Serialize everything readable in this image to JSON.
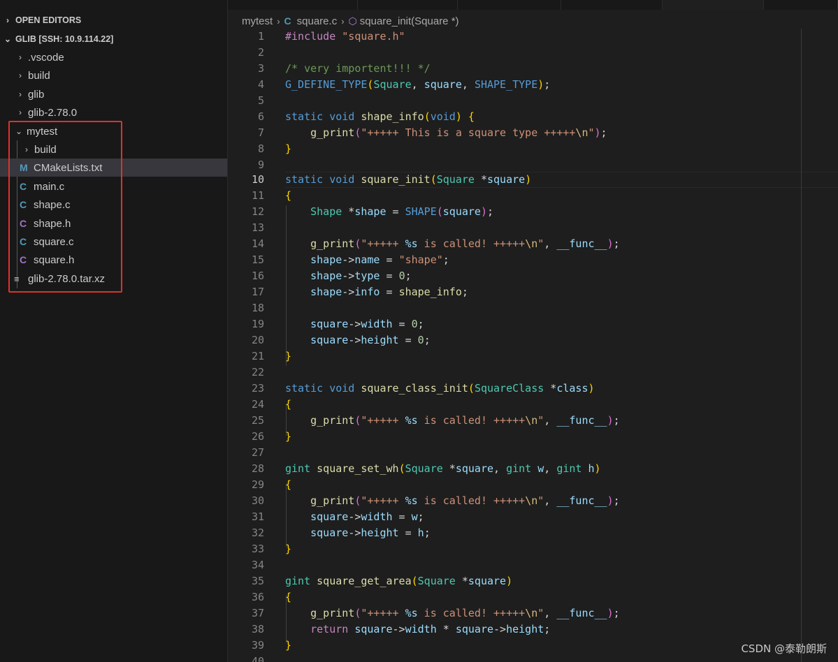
{
  "sidebar": {
    "open_editors_label": "OPEN EDITORS",
    "workspace_label": "GLIB [SSH: 10.9.114.22]",
    "items": [
      {
        "label": ".vscode",
        "kind": "folder",
        "expanded": false
      },
      {
        "label": "build",
        "kind": "folder",
        "expanded": false
      },
      {
        "label": "glib",
        "kind": "folder",
        "expanded": false
      },
      {
        "label": "glib-2.78.0",
        "kind": "folder",
        "expanded": false
      },
      {
        "label": "mytest",
        "kind": "folder",
        "expanded": true
      },
      {
        "label": "build",
        "kind": "folder",
        "expanded": false
      },
      {
        "label": "CMakeLists.txt",
        "kind": "file",
        "icon": "cmake-m-icon",
        "icon_glyph": "M"
      },
      {
        "label": "main.c",
        "kind": "file",
        "icon": "c-file-icon",
        "icon_glyph": "C"
      },
      {
        "label": "shape.c",
        "kind": "file",
        "icon": "c-file-icon",
        "icon_glyph": "C"
      },
      {
        "label": "shape.h",
        "kind": "file",
        "icon": "h-file-icon",
        "icon_glyph": "C"
      },
      {
        "label": "square.c",
        "kind": "file",
        "icon": "c-file-icon",
        "icon_glyph": "C"
      },
      {
        "label": "square.h",
        "kind": "file",
        "icon": "h-file-icon",
        "icon_glyph": "C"
      },
      {
        "label": "glib-2.78.0.tar.xz",
        "kind": "file",
        "icon": "text-lines-icon",
        "icon_glyph": "≡"
      }
    ],
    "highlight_color": "#e0312b"
  },
  "breadcrumb": {
    "folder": "mytest",
    "file": "square.c",
    "symbol": "square_init(Square *)"
  },
  "editor": {
    "active_line": 10,
    "line_count_shown": 40
  },
  "watermark": "CSDN @泰勒朗斯"
}
